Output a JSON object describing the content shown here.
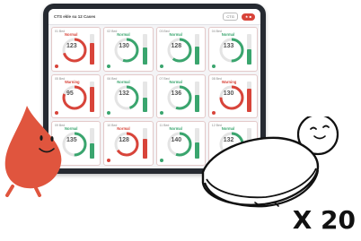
{
  "header": {
    "title": "CTS ekle su 12 Cases",
    "device_label": "CTG",
    "action_label": "★ ■"
  },
  "cards": [
    {
      "label": "01 Bed",
      "state": "Normal",
      "value": "123",
      "color": "#d8443a",
      "level": 0.7
    },
    {
      "label": "02 Bed",
      "state": "Normal",
      "value": "130",
      "color": "#3aa56e",
      "level": 0.55
    },
    {
      "label": "03 Bed",
      "state": "Normal",
      "value": "128",
      "color": "#3aa56e",
      "level": 0.6
    },
    {
      "label": "04 Bed",
      "state": "Normal",
      "value": "133",
      "color": "#3aa56e",
      "level": 0.5
    },
    {
      "label": "05 Bed",
      "state": "Warning",
      "value": "95",
      "color": "#d8443a",
      "level": 0.8
    },
    {
      "label": "06 Bed",
      "state": "Normal",
      "value": "132",
      "color": "#3aa56e",
      "level": 0.45
    },
    {
      "label": "07 Bed",
      "state": "Normal",
      "value": "136",
      "color": "#3aa56e",
      "level": 0.55
    },
    {
      "label": "08 Bed",
      "state": "Warning",
      "value": "130",
      "color": "#d8443a",
      "level": 0.75
    },
    {
      "label": "09 Bed",
      "state": "Normal",
      "value": "135",
      "color": "#3aa56e",
      "level": 0.5
    },
    {
      "label": "10 Bed",
      "state": "Normal",
      "value": "128",
      "color": "#d8443a",
      "level": 0.65
    },
    {
      "label": "11 Bed",
      "state": "Normal",
      "value": "140",
      "color": "#3aa56e",
      "level": 0.55
    },
    {
      "label": "12 Bed",
      "state": "Normal",
      "value": "132",
      "color": "#3aa56e",
      "level": 0.6
    }
  ],
  "mascot_color": "#e0553e",
  "multiplier": "X 20"
}
